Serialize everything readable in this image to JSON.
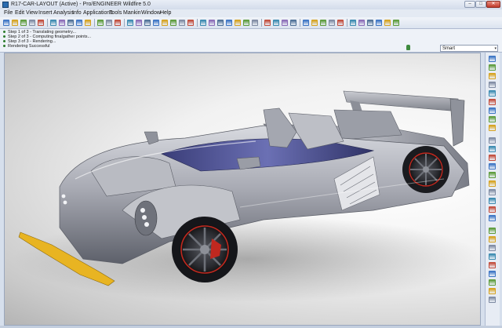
{
  "window": {
    "title": "R17-CAR-LAYOUT (Active) - Pro/ENGINEER Wildfire 5.0",
    "min_glyph": "–",
    "max_glyph": "□",
    "close_glyph": "✕"
  },
  "menu": [
    "File",
    "Edit",
    "View",
    "Insert",
    "Analysis",
    "Info",
    "Applications",
    "Tools",
    "Mankin",
    "Window",
    "Help"
  ],
  "toolbar": {
    "icons": [
      "new-icon",
      "open-icon",
      "save-icon",
      "print-icon",
      "email-icon",
      "undo-icon",
      "redo-icon",
      "cut-icon",
      "copy-icon",
      "paste-icon",
      "regenerate-icon",
      "find-icon",
      "select-icon",
      "repaint-icon",
      "spin-icon",
      "orient-icon",
      "zoom-in-icon",
      "zoom-out-icon",
      "refit-icon",
      "reorient-icon",
      "saved-views-icon",
      "layers-icon",
      "view-manager-icon",
      "wireframe-icon",
      "hidden-line-icon",
      "no-hidden-icon",
      "shading-icon",
      "datum-planes-icon",
      "datum-axes-icon",
      "datum-points-icon",
      "csys-icon",
      "annotations-icon",
      "render-icon",
      "appearance-icon",
      "scene-icon",
      "light-icon",
      "room-icon",
      "perspective-icon",
      "measure-icon",
      "section-icon",
      "explode-icon",
      "family-table-icon",
      "context-help-icon"
    ]
  },
  "messages": [
    "Step 1 of 3 - Translating geometry...",
    "Step 2 of 3 - Computing finalgather points...",
    "Step 3 of 3 - Rendering...",
    "Rendering Successful"
  ],
  "filter": {
    "selected": "Smart",
    "arrow": "▾"
  },
  "right_toolbar": {
    "icons": [
      "sketch-icon",
      "rectangle-icon",
      "circle-icon",
      "arc-icon",
      "spline-icon",
      "point-icon",
      "csys-datum-icon",
      "axis-icon",
      "plane-icon",
      "extrude-icon",
      "revolve-icon",
      "sweep-icon",
      "blend-icon",
      "hole-icon",
      "round-icon",
      "chamfer-icon",
      "shell-icon",
      "rib-icon",
      "draft-icon",
      "pattern-icon",
      "mirror-icon",
      "merge-icon",
      "trim-icon",
      "offset-icon",
      "thicken-icon",
      "solidify-icon",
      "copy-geom-icon",
      "publish-icon"
    ]
  },
  "colors": {
    "accent": "#2a6bb0",
    "body_silver": "#a9abb4",
    "cockpit_blue": "#5a5e9e",
    "splitter_yellow": "#e8b422",
    "brake_red": "#c0281f"
  }
}
